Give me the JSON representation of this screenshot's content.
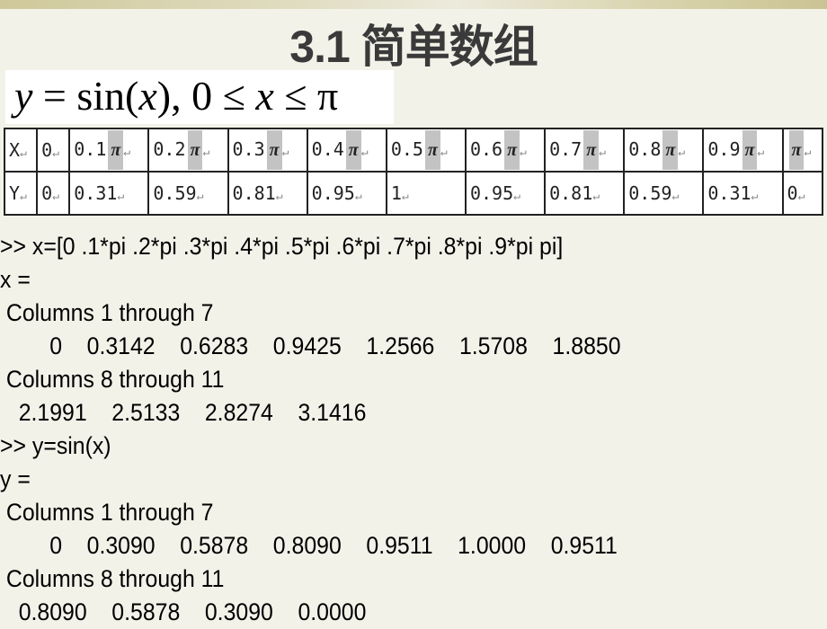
{
  "slide": {
    "title": "3.1 简单数组",
    "formula": {
      "lhs": "y",
      "eq": " = sin(",
      "var": "x",
      "mid": "), 0 ≤ ",
      "var2": "x",
      "rhs": " ≤ π"
    },
    "table": {
      "row_x": {
        "label": "X",
        "cells": [
          {
            "num": "0",
            "pi": ""
          },
          {
            "num": "0.1",
            "pi": "π"
          },
          {
            "num": "0.2",
            "pi": "π"
          },
          {
            "num": "0.3",
            "pi": "π"
          },
          {
            "num": "0.4",
            "pi": "π"
          },
          {
            "num": "0.5",
            "pi": "π"
          },
          {
            "num": "0.6",
            "pi": "π"
          },
          {
            "num": "0.7",
            "pi": "π"
          },
          {
            "num": "0.8",
            "pi": "π"
          },
          {
            "num": "0.9",
            "pi": "π"
          },
          {
            "num": "",
            "pi": "π"
          }
        ]
      },
      "row_y": {
        "label": "Y",
        "cells": [
          "0",
          "0.31",
          "0.59",
          "0.81",
          "0.95",
          "1",
          "0.95",
          "0.81",
          "0.59",
          "0.31",
          "0"
        ]
      },
      "return_mark": "↵"
    },
    "console": [
      ">> x=[0 .1*pi .2*pi .3*pi .4*pi .5*pi .6*pi .7*pi .8*pi .9*pi pi]",
      "x =",
      " Columns 1 through 7",
      "        0    0.3142    0.6283    0.9425    1.2566    1.5708    1.8850",
      " Columns 8 through 11",
      "   2.1991    2.5133    2.8274    3.1416",
      ">> y=sin(x)",
      "y =",
      " Columns 1 through 7",
      "        0    0.3090    0.5878    0.8090    0.9511    1.0000    0.9511",
      " Columns 8 through 11",
      "   0.8090    0.5878    0.3090    0.0000"
    ]
  }
}
